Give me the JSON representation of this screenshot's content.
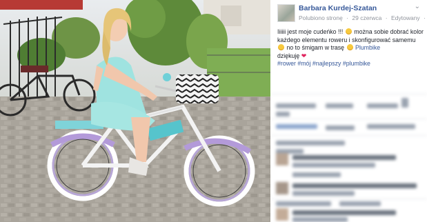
{
  "post": {
    "author": "Barbara Kurdej-Szatan",
    "liked_label": "Polubiono stronę",
    "date": "29 czerwca",
    "separator": "·",
    "edited": "Edytowany",
    "text_part1": "Iiiiii jest moje cudeńko !!!",
    "text_part2": "można sobie dobrać kolor każdego elementu roweru i skonfigurować samemu",
    "text_part3": "no to śmigam w trasę",
    "mention": "Plumbike",
    "text_part4": "dziękuję",
    "hashtags": "#rower #mój #najlepszy #plumbike"
  },
  "icons": {
    "chevron": "chevron-down-icon",
    "globe": "globe-icon",
    "emoji": "smile-emoji-icon",
    "heart": "heart-icon"
  },
  "colors": {
    "link": "#365899",
    "meta": "#90949c",
    "text": "#1d2129"
  }
}
